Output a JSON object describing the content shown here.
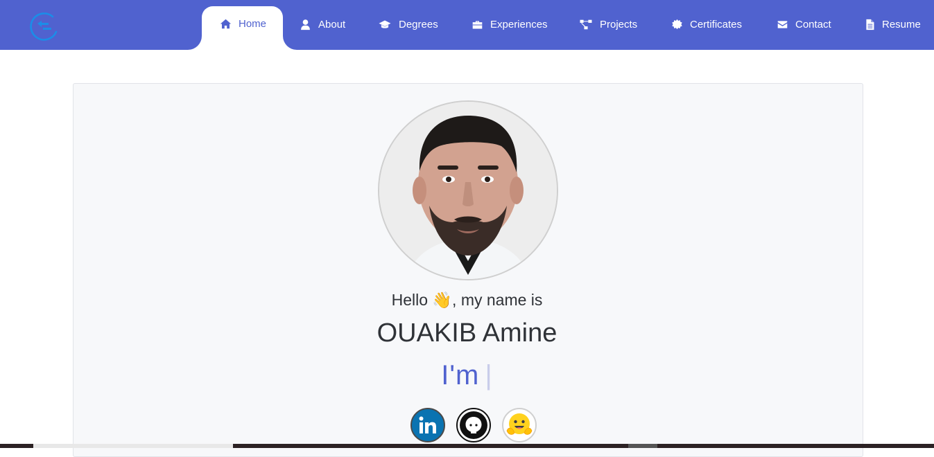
{
  "nav": {
    "items": [
      {
        "label": "Home",
        "icon": "home-icon",
        "active": true
      },
      {
        "label": "About",
        "icon": "user-icon",
        "active": false
      },
      {
        "label": "Degrees",
        "icon": "graduation-cap-icon",
        "active": false
      },
      {
        "label": "Experiences",
        "icon": "briefcase-icon",
        "active": false
      },
      {
        "label": "Projects",
        "icon": "project-diagram-icon",
        "active": false
      },
      {
        "label": "Certificates",
        "icon": "certificate-icon",
        "active": false
      },
      {
        "label": "Contact",
        "icon": "envelope-icon",
        "active": false
      },
      {
        "label": "Resume",
        "icon": "file-icon",
        "active": false
      }
    ]
  },
  "hero": {
    "hello": "Hello 👋, my name is",
    "name": "OUAKIB Amine",
    "typed_prefix": "I'm",
    "caret": "|"
  },
  "socials": [
    {
      "name": "linkedin",
      "icon": "linkedin-icon"
    },
    {
      "name": "github",
      "icon": "github-icon"
    },
    {
      "name": "huggingface",
      "icon": "hugging-face-icon"
    }
  ],
  "colors": {
    "brand": "#5062cf",
    "text": "#2f3237",
    "card_bg": "#f7f8fa"
  }
}
